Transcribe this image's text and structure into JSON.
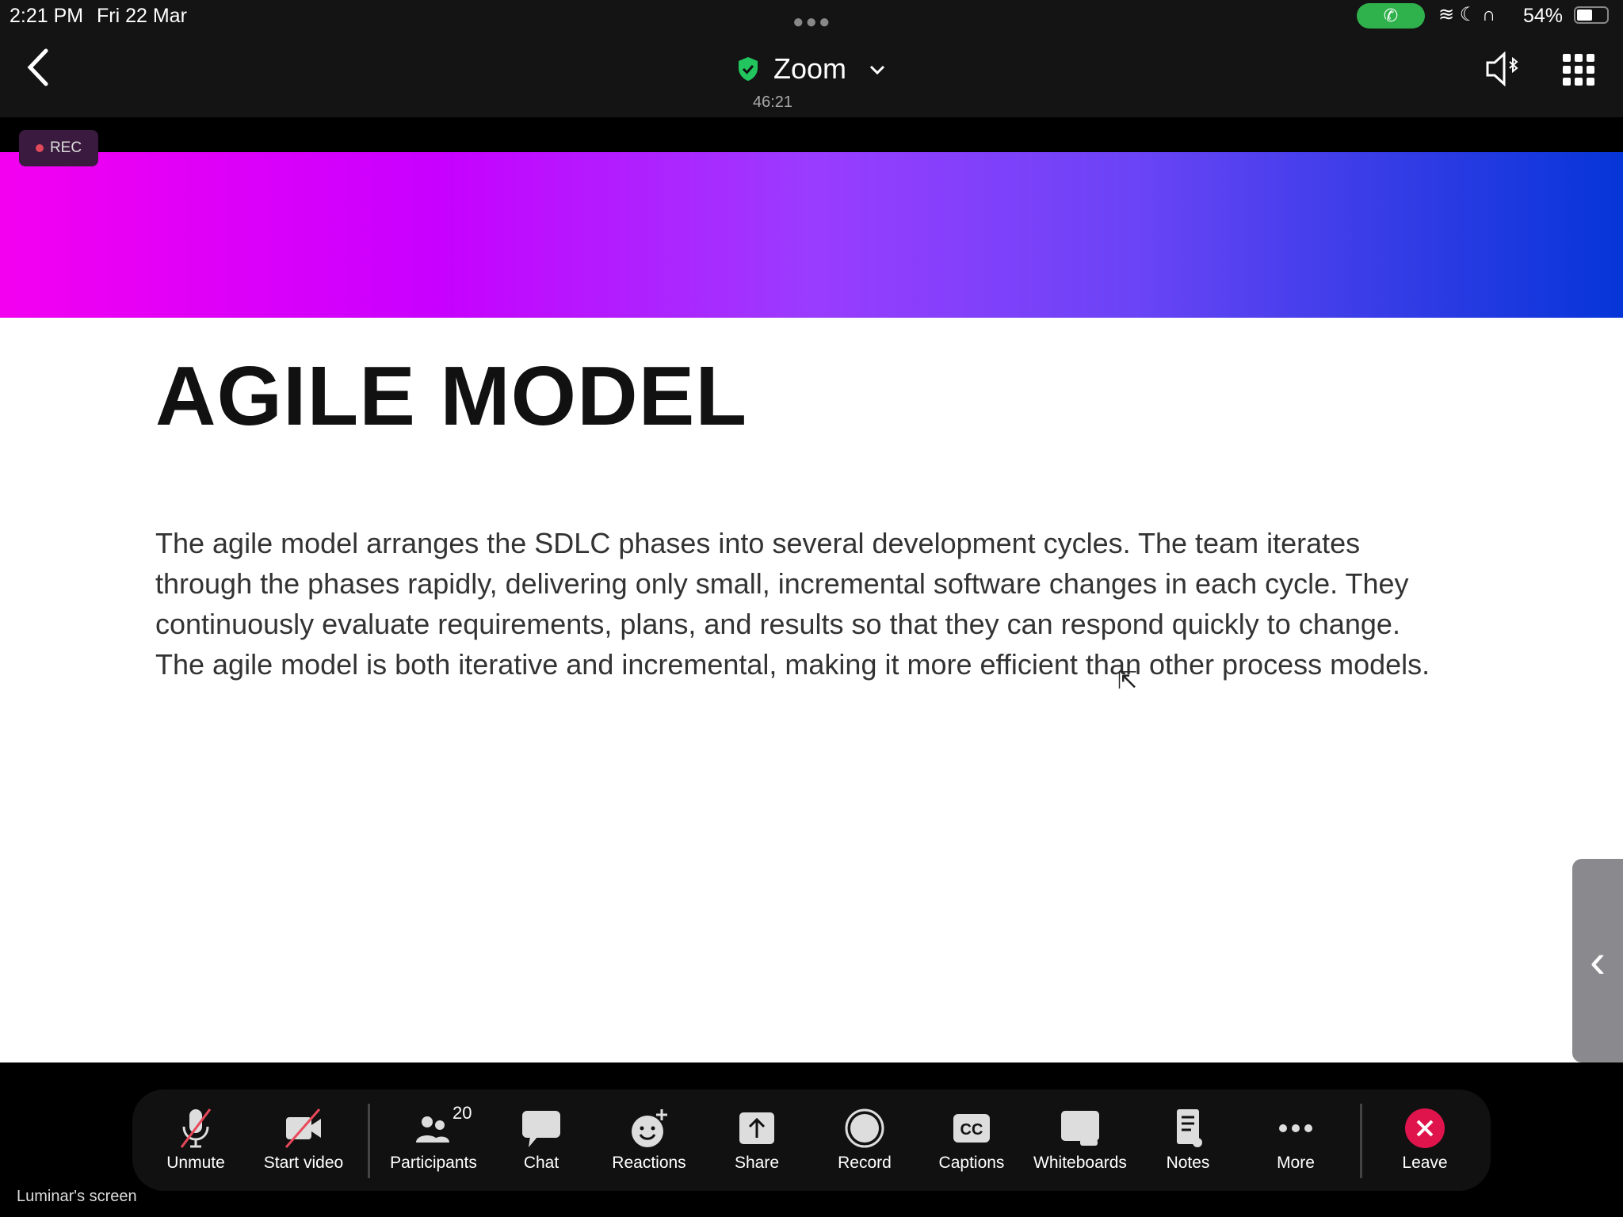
{
  "status_bar": {
    "time": "2:21 PM",
    "date": "Fri 22 Mar",
    "battery": "54%"
  },
  "header": {
    "title": "Zoom",
    "timer": "46:21",
    "accent": "#22c55e"
  },
  "rec_badge": "REC",
  "slide": {
    "title": "AGILE MODEL",
    "body": "The agile model arranges the SDLC phases into several development cycles. The team iterates through the phases rapidly, delivering only small, incremental software changes in each cycle. They continuously evaluate requirements, plans, and results so that they can respond quickly to change. The agile model is both iterative and incremental, making it more efficient than other process models."
  },
  "toolbar": {
    "items": [
      {
        "label": "Unmute",
        "icon": "mic-muted-icon"
      },
      {
        "label": "Start video",
        "icon": "video-off-icon"
      },
      {
        "label": "Participants",
        "icon": "participants-icon",
        "badge": "20"
      },
      {
        "label": "Chat",
        "icon": "chat-icon"
      },
      {
        "label": "Reactions",
        "icon": "reactions-icon"
      },
      {
        "label": "Share",
        "icon": "share-icon"
      },
      {
        "label": "Record",
        "icon": "record-icon"
      },
      {
        "label": "Captions",
        "icon": "captions-icon",
        "glyph": "CC"
      },
      {
        "label": "Whiteboards",
        "icon": "whiteboard-icon"
      },
      {
        "label": "Notes",
        "icon": "notes-icon"
      },
      {
        "label": "More",
        "icon": "more-icon"
      },
      {
        "label": "Leave",
        "icon": "leave-icon",
        "color": "#e0144c"
      }
    ]
  },
  "screen_label": "Luminar's screen"
}
